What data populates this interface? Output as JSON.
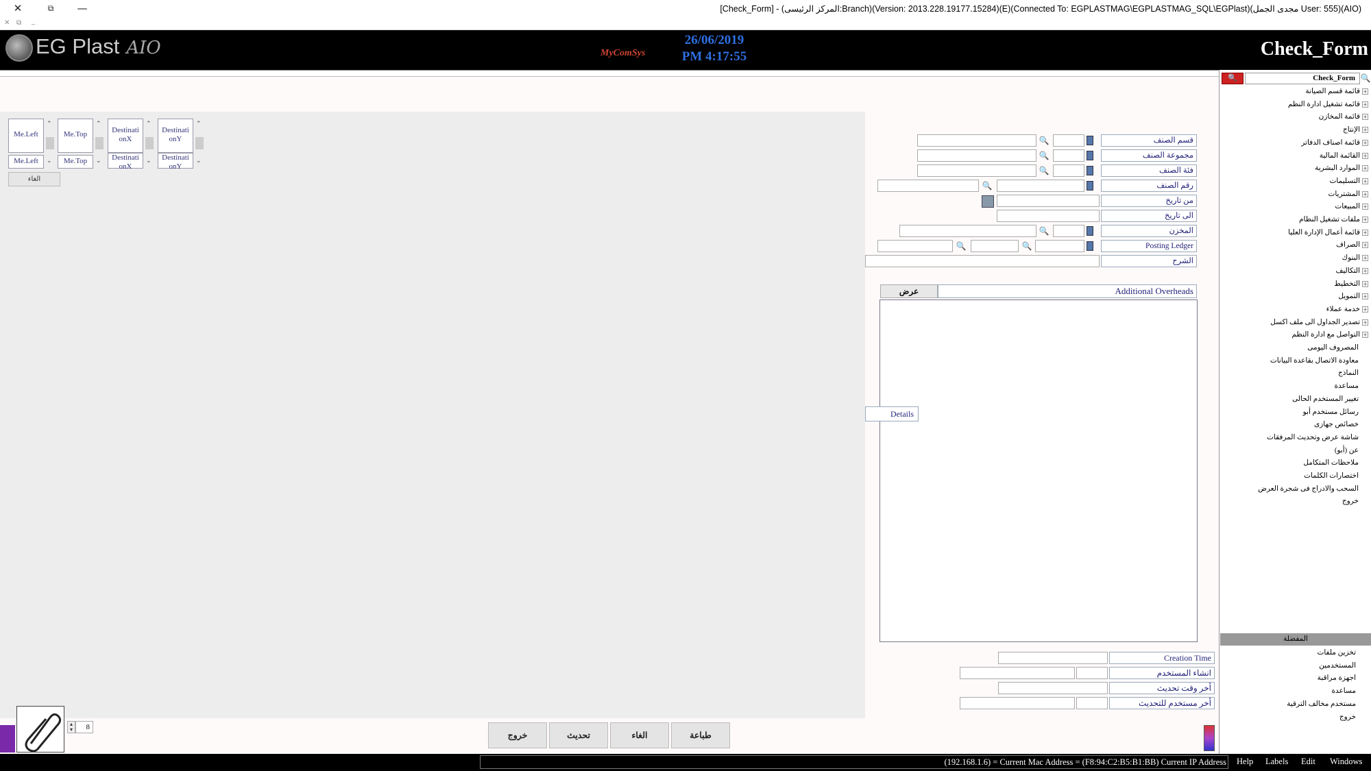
{
  "window": {
    "title": "[Check_Form] - (المركز الرئيسى:Branch)(Version: 2013.228.19177.15284)(E)(Connected To: EGPLASTMAG\\EGPLASTMAG_SQL\\EGPlast)(مجدى الجمل User: 555)(AIO)",
    "close": "✕",
    "restore": "⧉",
    "minimize": "—"
  },
  "mdi": {
    "close": "✕",
    "restore": "⧉",
    "minimize": "_"
  },
  "header": {
    "logo_text": "EG Plast",
    "logo_suffix": "AIO",
    "brand": "MyComSys",
    "date": "26/06/2019",
    "time": "PM 4:17:55",
    "form_title": "Check_Form"
  },
  "sidebar": {
    "search_value": "Check_Form",
    "search_icon": "🔍",
    "items": [
      "قائمة قسم الصيانة",
      "قائمة تشغيل ادارة النظم",
      "قائمة المخازن",
      "الإنتاج",
      "قائمة اصناف الدفاتر",
      "القائمة المالية",
      "الموارد البشرية",
      "التسليمات",
      "المشتريات",
      "المبيعات",
      "ملفات تشغيل النظام",
      "قائمة أعمال الإدارة العليا",
      "الصراف",
      "البنوك",
      "التكاليف",
      "التخطيط",
      "التمويل",
      "خدمة عملاء",
      "تصدير الجداول الى ملف اكسل",
      "التواصل مع ادارة النظم",
      "المصروف اليومى",
      "معاودة الاتصال بقاعدة البيانات",
      "النماذج",
      "مساعدة",
      "تغيير المستخدم الحالى",
      "رسائل مستخدم أبو",
      "خصائص جهازى",
      "شاشة عرض وتحديث المرفقات",
      "عن (أبو)",
      "ملاحظات المتكامل",
      "اختصارات الكلمات",
      "السحب والادراج فى شجرة العرض",
      "خروج"
    ],
    "favorites_header": "المفضلة",
    "favorites": [
      "تخزين ملفات",
      "المستخدمين",
      "اجهزة مراقبة",
      "مساعدة",
      "مستخدم مخالف الترقية",
      "خروج"
    ]
  },
  "form": {
    "labels": [
      "قسم الصنف",
      "مجموعة الصنف",
      "فئة الصنف",
      "رقم الصنف",
      "من تاريخ",
      "الى تاريخ",
      "المخزن",
      "Posting Ledger",
      "الشرح"
    ],
    "additional_label": "Additional Overheads",
    "show_button": "عرض",
    "details_button": "Details",
    "audit_labels": [
      "Creation Time",
      "انشاء المستخدم",
      "أخر وقت تحديث",
      "أخر مستخدم للتحديث"
    ]
  },
  "debug": {
    "me_left": "Me.Left",
    "me_top": "Me.Top",
    "dest_x": "Destinati onX",
    "dest_y": "Destinati onY",
    "cancel": "الغاء"
  },
  "footer": {
    "buttons": [
      "خروج",
      "تحديث",
      "الغاء",
      "طباعة"
    ],
    "attachment_count": "8"
  },
  "status": {
    "address": "(192.168.1.6) = Current Mac Address = (F8:94:C2:B5:B1:BB) Current IP Address",
    "menus": [
      "Help",
      "Labels",
      "Edit",
      "Windows"
    ]
  }
}
